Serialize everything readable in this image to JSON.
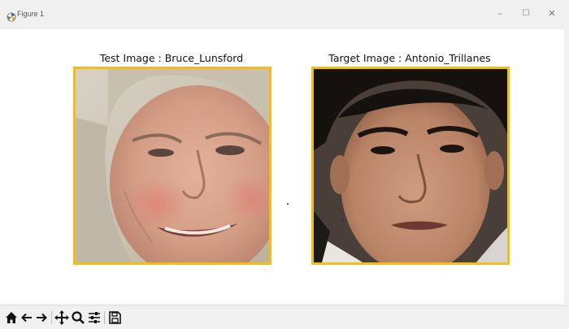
{
  "window": {
    "title": "Figure 1",
    "controls": {
      "minimize": "–",
      "maximize": "☐",
      "close": "✕"
    }
  },
  "figure": {
    "left_panel": {
      "title": "Test Image : Bruce_Lunsford",
      "border_color": "#f2bd1a"
    },
    "right_panel": {
      "title": "Target Image : Antonio_Trillanes",
      "border_color": "#f2bd1a"
    }
  },
  "toolbar": {
    "tools": [
      "home-icon",
      "back-arrow-icon",
      "forward-arrow-icon",
      "pan-icon",
      "zoom-icon",
      "configure-subplots-icon",
      "save-icon"
    ]
  }
}
